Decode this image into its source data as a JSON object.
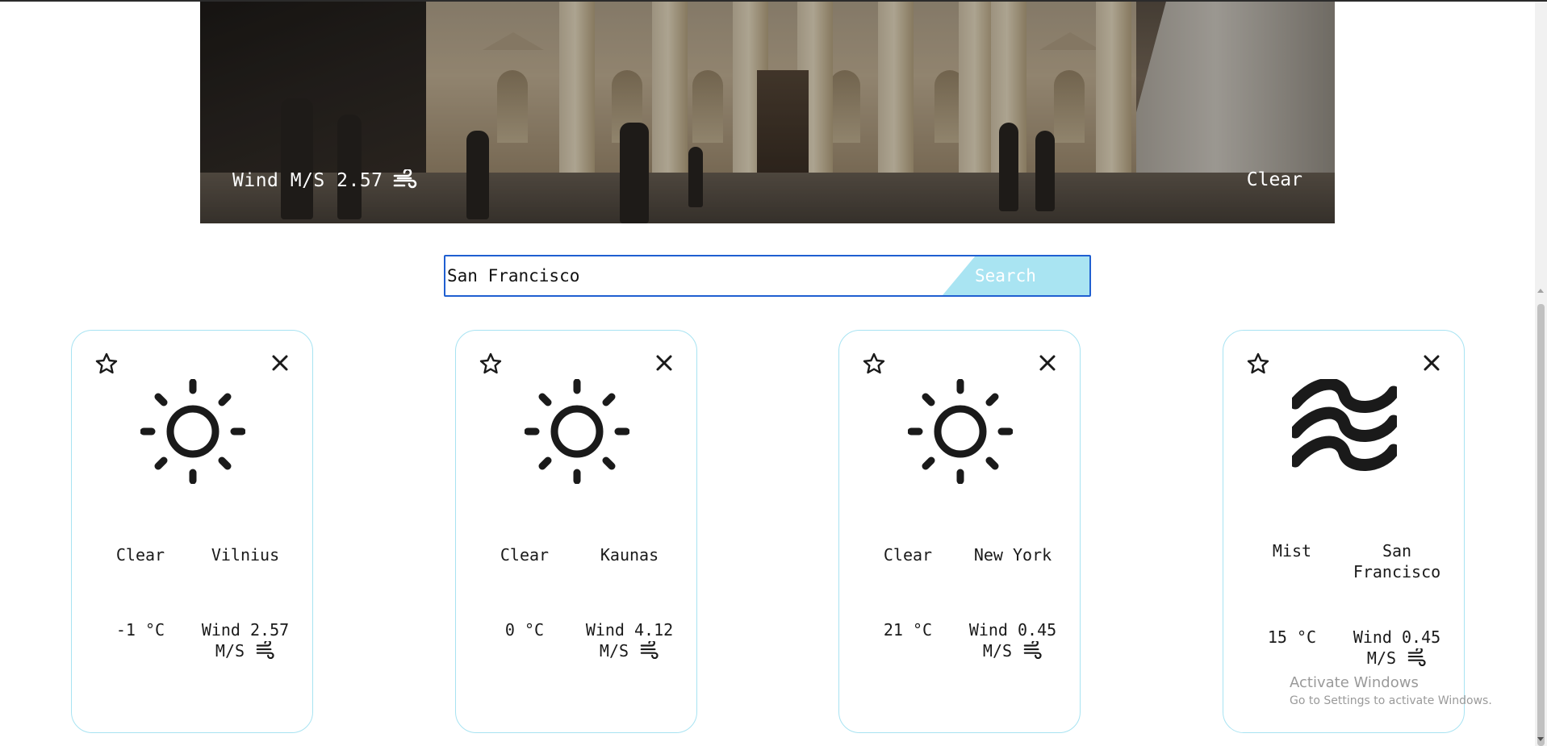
{
  "hero": {
    "wind_label": "Wind M/S 2.57",
    "wind_icon": "wind-icon",
    "condition": "Clear"
  },
  "search": {
    "value": "San Francisco",
    "button_label": "Search"
  },
  "cards": [
    {
      "condition": "Clear",
      "city": "Vilnius",
      "temperature": "-1 °C",
      "wind_line1": "Wind 2.57",
      "wind_line2": "M/S",
      "icon": "sun-icon"
    },
    {
      "condition": "Clear",
      "city": "Kaunas",
      "temperature": "0 °C",
      "wind_line1": "Wind 4.12",
      "wind_line2": "M/S",
      "icon": "sun-icon"
    },
    {
      "condition": "Clear",
      "city": "New York",
      "temperature": "21 °C",
      "wind_line1": "Wind 0.45",
      "wind_line2": "M/S",
      "icon": "sun-icon"
    },
    {
      "condition": "Mist",
      "city": "San Francisco",
      "temperature": "15 °C",
      "wind_line1": "Wind 0.45",
      "wind_line2": "M/S",
      "icon": "mist-icon"
    }
  ],
  "watermark": {
    "title": "Activate Windows",
    "subtitle": "Go to Settings to activate Windows."
  },
  "colors": {
    "accent": "#a9e4f2",
    "card_border": "#a8e3f2",
    "search_border": "#1f5fd1"
  }
}
